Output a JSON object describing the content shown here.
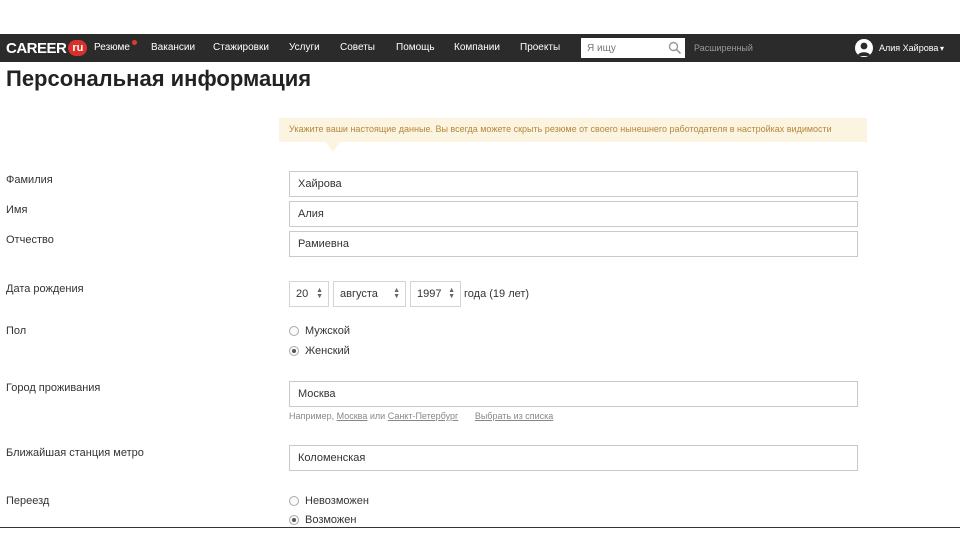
{
  "header": {
    "logo_main": "CAREER",
    "logo_badge": "ru",
    "nav": [
      {
        "label": "Резюме"
      },
      {
        "label": "Вакансии"
      },
      {
        "label": "Стажировки"
      },
      {
        "label": "Услуги"
      },
      {
        "label": "Советы"
      },
      {
        "label": "Помощь"
      },
      {
        "label": "Компании"
      },
      {
        "label": "Проекты"
      }
    ],
    "search_placeholder": "Я ищу",
    "advanced_label": "Расширенный",
    "user_name": "Алия Хайрова",
    "user_chevron": "▾"
  },
  "page": {
    "title": "Персональная информация",
    "notice": "Укажите ваши настоящие данные. Вы всегда можете скрыть резюме от своего нынешнего работодателя в настройках видимости"
  },
  "form": {
    "last_name": {
      "label": "Фамилия",
      "value": "Хайрова"
    },
    "first_name": {
      "label": "Имя",
      "value": "Алия"
    },
    "patronymic": {
      "label": "Отчество",
      "value": "Рамиевна"
    },
    "birth_date": {
      "label": "Дата рождения",
      "day": "20",
      "month": "августа",
      "year": "1997",
      "age_text": "года (19 лет)"
    },
    "gender": {
      "label": "Пол",
      "options": [
        "Мужской",
        "Женский"
      ],
      "selected": "Женский"
    },
    "city": {
      "label": "Город проживания",
      "value": "Москва",
      "hint_prefix": "Например,",
      "hint_example_1": "Москва",
      "hint_or": "или",
      "hint_example_2": "Санкт-Петербург",
      "hint_select": "Выбрать из списка"
    },
    "metro": {
      "label": "Ближайшая станция метро",
      "value": "Коломенская"
    },
    "relocation": {
      "label": "Переезд",
      "options": [
        "Невозможен",
        "Возможен"
      ],
      "selected": "Возможен"
    }
  },
  "colors": {
    "topbar": "#2b2b2b",
    "brand_red": "#d9302a",
    "notice_bg": "#fbf4e1",
    "notice_text": "#b5883b"
  }
}
